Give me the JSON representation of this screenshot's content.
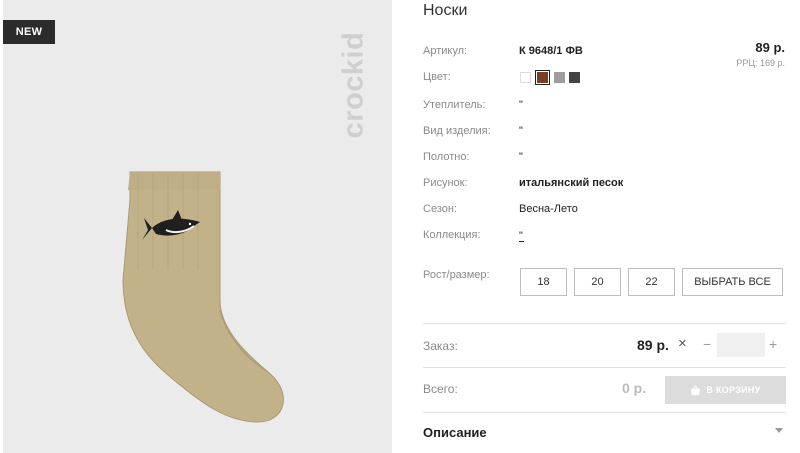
{
  "badge": {
    "text": "NEW"
  },
  "brand": {
    "logo_text": "crockid"
  },
  "product": {
    "title": "Носки",
    "price": "89 р.",
    "rrc": "РРЦ: 169 р."
  },
  "specs": {
    "article_label": "Артикул:",
    "article_value": "К 9648/1 ФВ",
    "color_label": "Цвет:",
    "colors": [
      "#ffffff",
      "#7a3e25",
      "#9e9e9e",
      "#444444"
    ],
    "insulation_label": "Утеплитель:",
    "insulation_value": "\"",
    "type_label": "Вид изделия:",
    "type_value": "\"",
    "fabric_label": "Полотно:",
    "fabric_value": "\"",
    "print_label": "Рисунок:",
    "print_value": "итальянский песок",
    "season_label": "Сезон:",
    "season_value": "Весна-Лето",
    "collection_label": "Коллекция:",
    "collection_value": "\""
  },
  "size": {
    "label": "Рост/размер:",
    "options": [
      "18",
      "20",
      "22"
    ],
    "select_all": "ВЫБРАТЬ ВСЕ"
  },
  "order": {
    "label": "Заказ:",
    "price": "89 р.",
    "times": "×",
    "minus": "−",
    "plus": "+",
    "quantity": ""
  },
  "total": {
    "label": "Всего:",
    "value": "0 р.",
    "cart_button": "В КОРЗИНУ"
  },
  "description": {
    "label": "Описание"
  }
}
